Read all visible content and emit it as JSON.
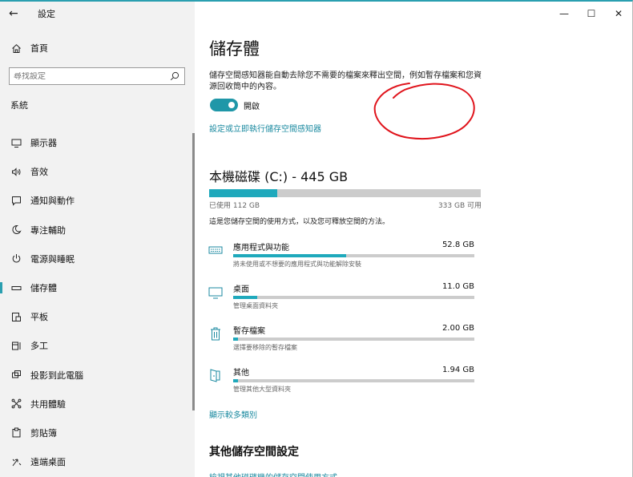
{
  "window": {
    "app_title": "設定",
    "back_glyph": "←",
    "minimize_glyph": "—",
    "maximize_glyph": "☐",
    "close_glyph": "✕"
  },
  "sidebar": {
    "home_label": "首頁",
    "search_placeholder": "尋找設定",
    "section": "系統",
    "items": [
      {
        "label": "顯示器",
        "icon": "monitor-icon"
      },
      {
        "label": "音效",
        "icon": "speaker-icon"
      },
      {
        "label": "通知與動作",
        "icon": "notification-icon"
      },
      {
        "label": "專注輔助",
        "icon": "moon-icon"
      },
      {
        "label": "電源與睡眠",
        "icon": "power-icon"
      },
      {
        "label": "儲存體",
        "icon": "storage-icon",
        "selected": true
      },
      {
        "label": "平板",
        "icon": "tablet-icon"
      },
      {
        "label": "多工",
        "icon": "multitask-icon"
      },
      {
        "label": "投影到此電腦",
        "icon": "project-icon"
      },
      {
        "label": "共用體驗",
        "icon": "share-icon"
      },
      {
        "label": "剪貼簿",
        "icon": "clipboard-icon"
      },
      {
        "label": "遠端桌面",
        "icon": "remote-icon"
      }
    ]
  },
  "main": {
    "title": "儲存體",
    "sense_desc": "儲存空間感知器能自動去除您不需要的檔案來釋出空間，例如暫存檔案和您資源回收筒中的內容。",
    "toggle_state": "開啟",
    "toggle_on": true,
    "config_link": "設定或立即執行儲存空間感知器",
    "drive": {
      "title": "本機磁碟 (C:) - 445 GB",
      "used_label": "已使用 112 GB",
      "free_label": "333 GB 可用",
      "used_fraction": 0.252
    },
    "usage_note": "這是您儲存空間的使用方式，以及您可釋放空間的方法。",
    "categories": [
      {
        "name": "應用程式與功能",
        "size": "52.8 GB",
        "desc": "將未使用或不想要的應用程式與功能解除安裝",
        "fraction": 0.47,
        "icon": "apps-icon"
      },
      {
        "name": "桌面",
        "size": "11.0 GB",
        "desc": "管理桌面資料夾",
        "fraction": 0.1,
        "icon": "desktop-icon"
      },
      {
        "name": "暫存檔案",
        "size": "2.00 GB",
        "desc": "選擇要移除的暫存檔案",
        "fraction": 0.02,
        "icon": "trash-icon"
      },
      {
        "name": "其他",
        "size": "1.94 GB",
        "desc": "管理其他大型資料夾",
        "fraction": 0.02,
        "icon": "folder-icon"
      }
    ],
    "more_link": "顯示較多類別",
    "other_title": "其他儲存空間設定",
    "other_link": "檢視其他磁碟機的儲存空間使用方式"
  },
  "colors": {
    "accent": "#1fa9bc",
    "link": "#1b8aa0",
    "annotation": "#e0141c"
  }
}
